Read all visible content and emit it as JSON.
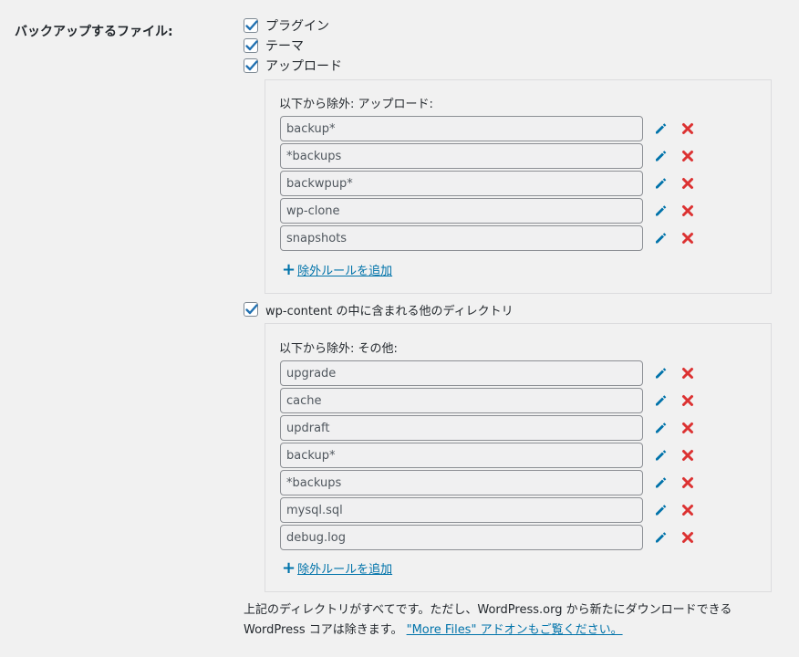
{
  "section_label": "バックアップするファイル:",
  "checkboxes": {
    "plugins": {
      "label": "プラグイン",
      "checked": true
    },
    "themes": {
      "label": "テーマ",
      "checked": true
    },
    "uploads": {
      "label": "アップロード",
      "checked": true
    },
    "others": {
      "label": "wp-content の中に含まれる他のディレクトリ",
      "checked": true
    }
  },
  "uploads_exclusions": {
    "title": "以下から除外: アップロード:",
    "rules": [
      "backup*",
      "*backups",
      "backwpup*",
      "wp-clone",
      "snapshots"
    ],
    "add_label": "除外ルールを追加"
  },
  "others_exclusions": {
    "title": "以下から除外: その他:",
    "rules": [
      "upgrade",
      "cache",
      "updraft",
      "backup*",
      "*backups",
      "mysql.sql",
      "debug.log"
    ],
    "add_label": "除外ルールを追加"
  },
  "footnote": {
    "text": "上記のディレクトリがすべてです。ただし、WordPress.org から新たにダウンロードできる WordPress コアは除きます。 ",
    "link": "\"More Files\" アドオンもご覧ください。"
  },
  "colors": {
    "accent": "#0073aa",
    "delete": "#dc3232",
    "check": "#2271b1"
  }
}
